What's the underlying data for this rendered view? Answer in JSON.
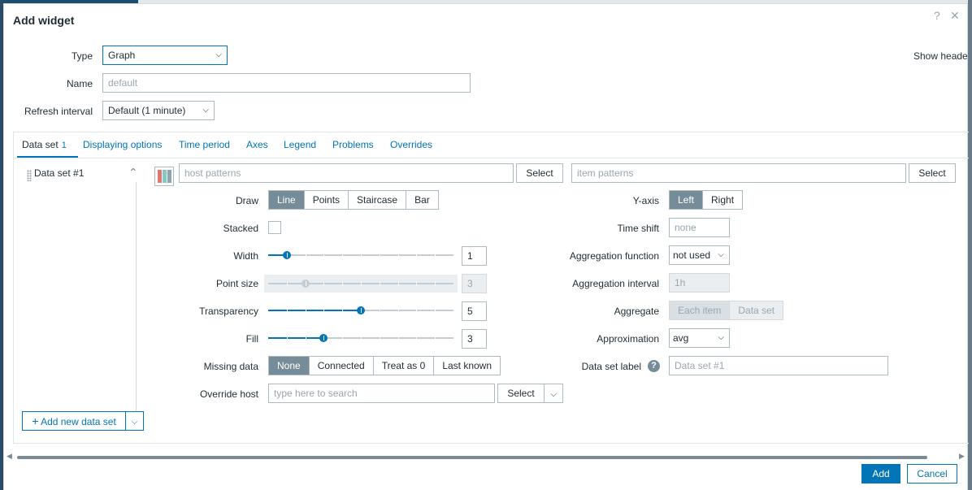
{
  "dialog": {
    "title": "Add widget",
    "help_icon": "?",
    "close_icon": "✕"
  },
  "form": {
    "type_label": "Type",
    "type_value": "Graph",
    "name_label": "Name",
    "name_placeholder": "default",
    "refresh_label": "Refresh interval",
    "refresh_value": "Default (1 minute)",
    "show_header_label": "Show heade"
  },
  "tabs": [
    {
      "label": "Data set",
      "count": "1"
    },
    {
      "label": "Displaying options"
    },
    {
      "label": "Time period"
    },
    {
      "label": "Axes"
    },
    {
      "label": "Legend"
    },
    {
      "label": "Problems"
    },
    {
      "label": "Overrides"
    }
  ],
  "dataset": {
    "name": "Data set #1",
    "host_placeholder": "host patterns",
    "item_placeholder": "item patterns",
    "select_label": "Select",
    "swatch_colors": [
      "#e57373",
      "#80cbc4",
      "#90a4ae"
    ],
    "draw_label": "Draw",
    "draw_options": [
      "Line",
      "Points",
      "Staircase",
      "Bar"
    ],
    "stacked_label": "Stacked",
    "width_label": "Width",
    "width_value": "1",
    "width_fraction": 0.1,
    "point_size_label": "Point size",
    "point_size_value": "3",
    "point_size_fraction": 0.2,
    "transparency_label": "Transparency",
    "transparency_value": "5",
    "transparency_fraction": 0.5,
    "fill_label": "Fill",
    "fill_value": "3",
    "fill_fraction": 0.3,
    "missing_label": "Missing data",
    "missing_options": [
      "None",
      "Connected",
      "Treat as 0",
      "Last known"
    ],
    "override_label": "Override host",
    "override_placeholder": "type here to search",
    "yaxis_label": "Y-axis",
    "yaxis_options": [
      "Left",
      "Right"
    ],
    "timeshift_label": "Time shift",
    "timeshift_placeholder": "none",
    "aggfunc_label": "Aggregation function",
    "aggfunc_value": "not used",
    "agginterval_label": "Aggregation interval",
    "agginterval_placeholder": "1h",
    "aggregate_label": "Aggregate",
    "aggregate_options": [
      "Each item",
      "Data set"
    ],
    "approx_label": "Approximation",
    "approx_value": "avg",
    "dslabel_label": "Data set label",
    "dslabel_placeholder": "Data set #1"
  },
  "add_dataset_label": "Add new data set",
  "footer": {
    "add_label": "Add",
    "cancel_label": "Cancel"
  },
  "colors": {
    "accent": "#0275b8",
    "segment_active": "#768d99"
  }
}
